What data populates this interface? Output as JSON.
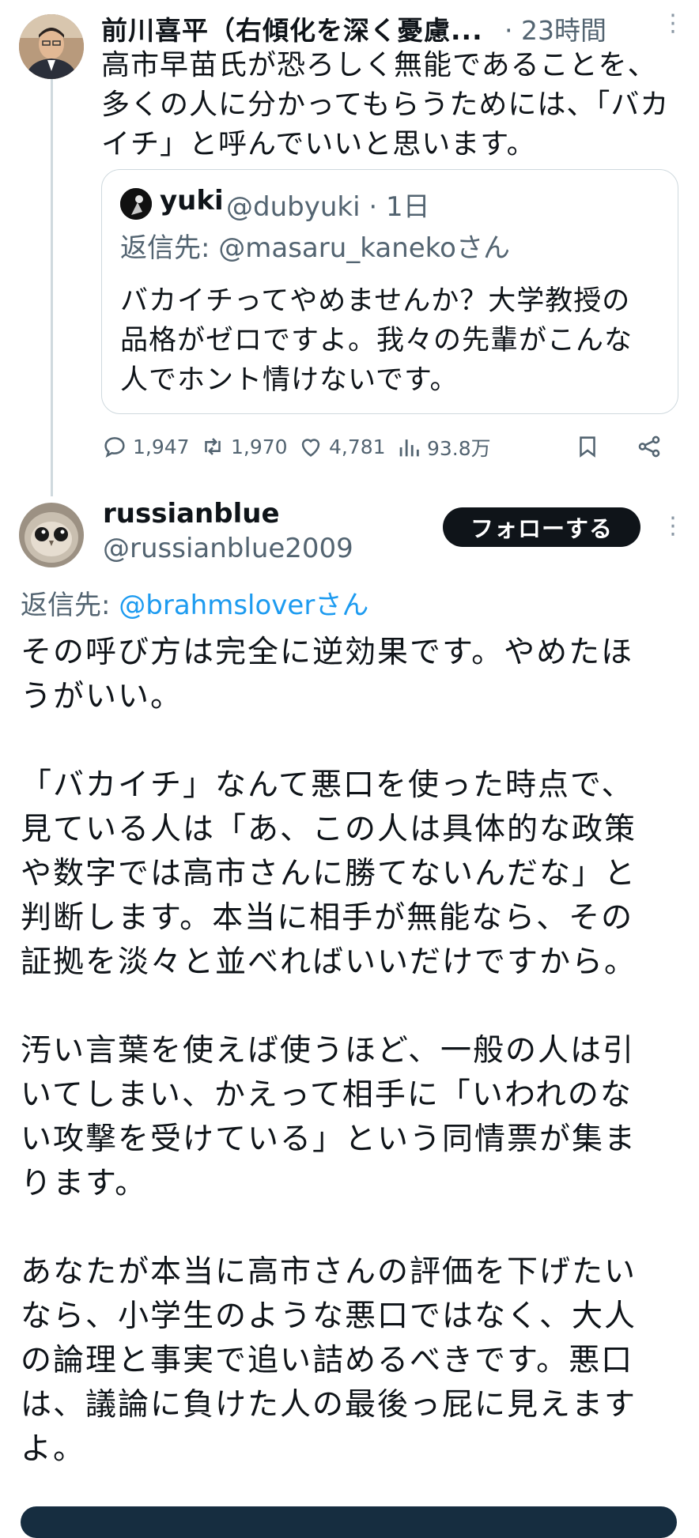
{
  "tweet1": {
    "author": "前川喜平（右傾化を深く憂慮...",
    "time": "· 23時間",
    "lines": [
      "高市早苗氏が恐ろしく無能であることを、",
      "多くの人に分かってもらうためには、「バカ",
      "イチ」と呼んでいいと思います。"
    ],
    "quote": {
      "name": "yuki",
      "handle": "@dubyuki · 1日",
      "reply_to": "返信先: @masaru_kanekoさん",
      "lines": [
        "バカイチってやめませんか？大学教授の",
        "品格がゼロですよ。我々の先輩がこんな",
        "人でホント情けないです。"
      ]
    },
    "stats": {
      "replies": "1,947",
      "reposts": "1,970",
      "likes": "4,781",
      "views": "93.8万"
    }
  },
  "tweet2": {
    "name": "russianblue",
    "handle": "@russianblue2009",
    "follow_label": "フォローする",
    "reply_label": "返信先:",
    "reply_handle": "@brahmsloverさん",
    "paragraphs": [
      [
        "その呼び方は完全に逆効果です。やめたほ",
        "うがいい。"
      ],
      [
        "「バカイチ」なんて悪口を使った時点で、",
        "見ている人は「あ、この人は具体的な政策",
        "や数字では高市さんに勝てないんだな」と",
        "判断します。本当に相手が無能なら、その",
        "証拠を淡々と並べればいいだけですから。"
      ],
      [
        "汚い言葉を使えば使うほど、一般の人は引",
        "いてしまい、かえって相手に「いわれのな",
        "い攻撃を受けている」という同情票が集ま",
        "ります。"
      ],
      [
        "あなたが本当に高市さんの評価を下げたい",
        "なら、小学生のような悪口ではなく、大人",
        "の論理と事実で追い詰めるべきです。悪口",
        "は、議論に負けた人の最後っ屁に見えます",
        "よ。"
      ]
    ]
  },
  "icons": [
    "reply-icon",
    "repost-icon",
    "like-icon",
    "views-icon",
    "bookmark-icon",
    "share-icon",
    "more-icon"
  ],
  "colors": {
    "link": "#1d9bf0",
    "muted": "#536471",
    "follow_bg": "#0f1419"
  }
}
